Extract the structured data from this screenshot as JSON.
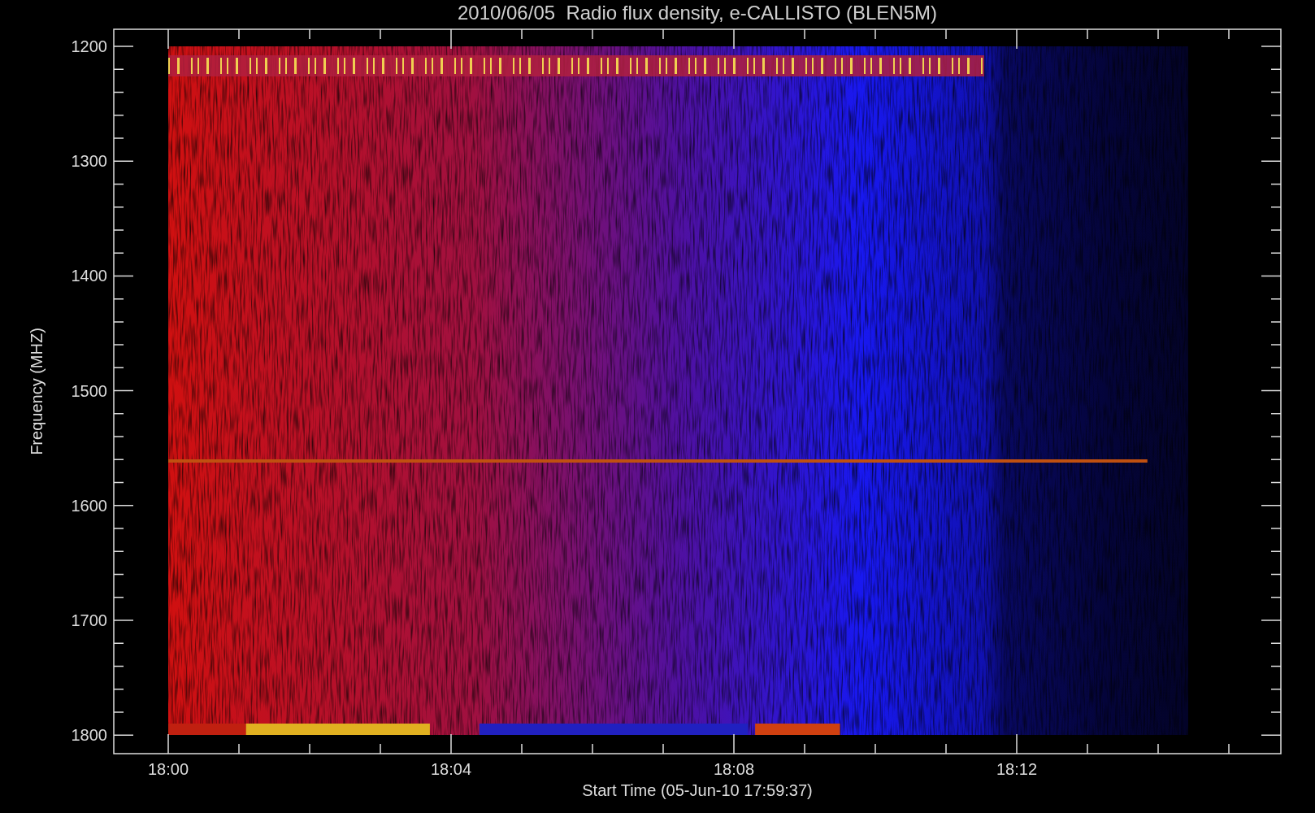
{
  "title": "2010/06/05  Radio flux density, e-CALLISTO (BLEN5M)",
  "y_axis": {
    "label": "Frequency (MHZ)",
    "ticks": [
      "1200",
      "1300",
      "1400",
      "1500",
      "1600",
      "1700",
      "1800"
    ]
  },
  "x_axis": {
    "label": "Start Time (05-Jun-10 17:59:37)",
    "ticks": [
      "18:00",
      "18:04",
      "18:08",
      "18:12"
    ]
  }
}
